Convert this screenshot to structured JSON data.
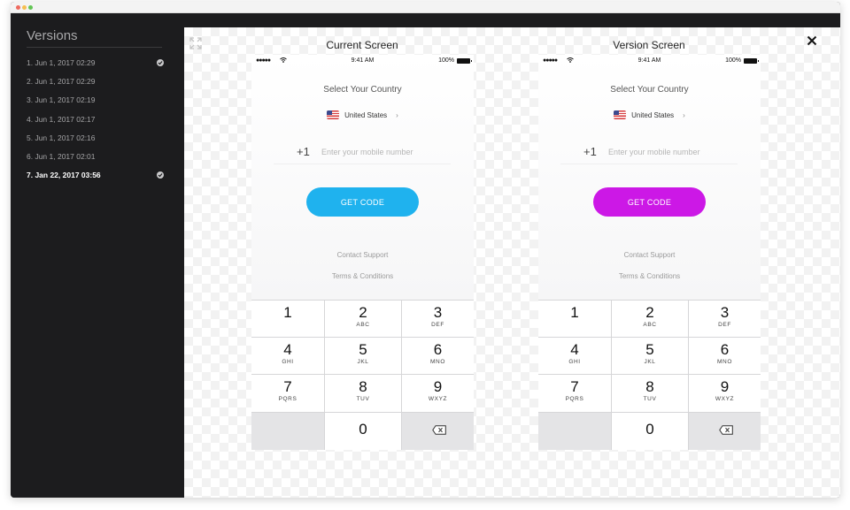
{
  "sidebar": {
    "title": "Versions",
    "items": [
      {
        "label": "1. Jun 1, 2017 02:29",
        "checked": true,
        "active": false
      },
      {
        "label": "2. Jun 1, 2017 02:29",
        "checked": false,
        "active": false
      },
      {
        "label": "3. Jun 1, 2017 02:19",
        "checked": false,
        "active": false
      },
      {
        "label": "4. Jun 1, 2017 02:17",
        "checked": false,
        "active": false
      },
      {
        "label": "5. Jun 1, 2017 02:16",
        "checked": false,
        "active": false
      },
      {
        "label": "6. Jun 1, 2017 02:01",
        "checked": false,
        "active": false
      },
      {
        "label": "7. Jan 22, 2017 03:56",
        "checked": true,
        "active": true
      }
    ]
  },
  "compare": {
    "close_icon": "close-icon",
    "expand_icon": "expand-icon"
  },
  "screens": [
    {
      "title": "Current Screen",
      "button_color": "#1fb2ee",
      "phone": {
        "status": {
          "signal": "●●●●●",
          "time": "9:41 AM",
          "battery": "100%"
        },
        "select_country": "Select Your Country",
        "country": "United States",
        "prefix": "+1",
        "placeholder": "Enter your mobile number",
        "button": "GET CODE",
        "contact": "Contact Support",
        "terms": "Terms & Conditions"
      }
    },
    {
      "title": "Version Screen",
      "button_color": "#cc18e6",
      "phone": {
        "status": {
          "signal": "●●●●●",
          "time": "9:41 AM",
          "battery": "100%"
        },
        "select_country": "Select Your Country",
        "country": "United States",
        "prefix": "+1",
        "placeholder": "Enter your mobile number",
        "button": "GET CODE",
        "contact": "Contact Support",
        "terms": "Terms & Conditions"
      }
    }
  ],
  "keypad": [
    {
      "num": "1",
      "letters": ""
    },
    {
      "num": "2",
      "letters": "ABC"
    },
    {
      "num": "3",
      "letters": "DEF"
    },
    {
      "num": "4",
      "letters": "GHI"
    },
    {
      "num": "5",
      "letters": "JKL"
    },
    {
      "num": "6",
      "letters": "MNO"
    },
    {
      "num": "7",
      "letters": "PQRS"
    },
    {
      "num": "8",
      "letters": "TUV"
    },
    {
      "num": "9",
      "letters": "WXYZ"
    },
    {
      "num": "",
      "letters": ""
    },
    {
      "num": "0",
      "letters": ""
    },
    {
      "num": "",
      "letters": "",
      "icon": "backspace-icon"
    }
  ]
}
